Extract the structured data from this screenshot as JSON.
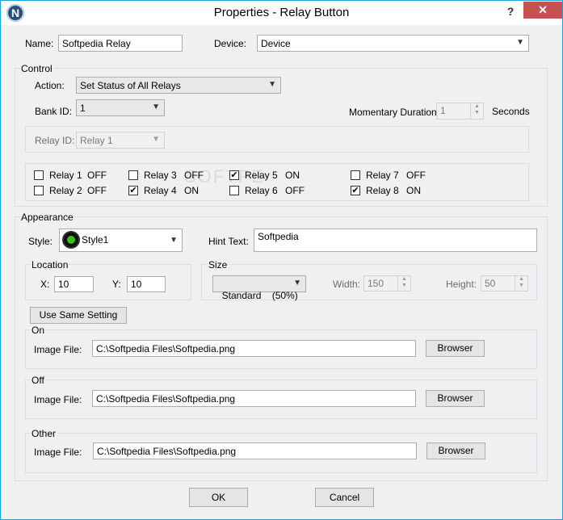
{
  "window": {
    "title": "Properties - Relay Button",
    "logo": "N",
    "help": "?",
    "close": "✕"
  },
  "name": {
    "label": "Name:",
    "value": "Softpedia Relay"
  },
  "device": {
    "label": "Device:",
    "value": "Device"
  },
  "control": {
    "title": "Control",
    "action_label": "Action:",
    "action_value": "Set Status of All Relays",
    "bank_label": "Bank ID:",
    "bank_value": "1",
    "momentary_label": "Momentary Duration:",
    "momentary_value": "1",
    "momentary_unit": "Seconds",
    "relay_id_label": "Relay ID:",
    "relay_id_value": "Relay 1",
    "relays": [
      {
        "label": "Relay 1",
        "status": "OFF",
        "checked": false
      },
      {
        "label": "Relay 2",
        "status": "OFF",
        "checked": false
      },
      {
        "label": "Relay 3",
        "status": "OFF",
        "checked": false
      },
      {
        "label": "Relay 4",
        "status": "ON",
        "checked": true
      },
      {
        "label": "Relay 5",
        "status": "ON",
        "checked": true
      },
      {
        "label": "Relay 6",
        "status": "OFF",
        "checked": false
      },
      {
        "label": "Relay 7",
        "status": "OFF",
        "checked": false
      },
      {
        "label": "Relay 8",
        "status": "ON",
        "checked": true
      }
    ]
  },
  "appearance": {
    "title": "Appearance",
    "style_label": "Style:",
    "style_value": "Style1",
    "hint_label": "Hint Text:",
    "hint_value": "Softpedia",
    "location": {
      "title": "Location",
      "x_label": "X:",
      "x_value": "10",
      "y_label": "Y:",
      "y_value": "10"
    },
    "size": {
      "title": "Size",
      "preset": "Standard    (50%)",
      "width_label": "Width:",
      "width_value": "150",
      "height_label": "Height:",
      "height_value": "50"
    },
    "use_same_label": "Use Same Setting",
    "on": {
      "title": "On",
      "image_label": "Image File:",
      "path": "C:\\Softpedia Files\\Softpedia.png",
      "browse": "Browser"
    },
    "off": {
      "title": "Off",
      "image_label": "Image File:",
      "path": "C:\\Softpedia Files\\Softpedia.png",
      "browse": "Browser"
    },
    "other": {
      "title": "Other",
      "image_label": "Image File:",
      "path": "C:\\Softpedia Files\\Softpedia.png",
      "browse": "Browser"
    }
  },
  "footer": {
    "ok": "OK",
    "cancel": "Cancel"
  },
  "watermark": "SOFTPE"
}
